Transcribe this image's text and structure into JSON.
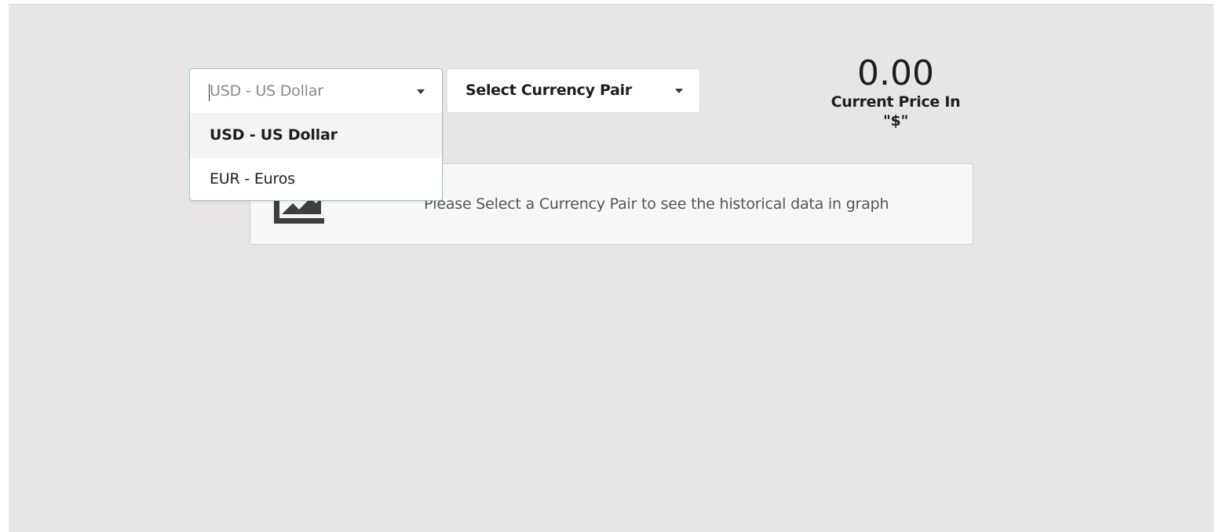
{
  "base_currency": {
    "search_text": "USD - US Dollar",
    "options": [
      {
        "label": "USD - US Dollar",
        "selected": true
      },
      {
        "label": "EUR - Euros",
        "selected": false
      }
    ]
  },
  "currency_pair": {
    "label": "Select Currency Pair"
  },
  "price": {
    "value": "0.00",
    "caption": "Current Price In \"$\""
  },
  "info": {
    "icon": "area-chart-icon",
    "message": "Please Select a Currency Pair to see the historical data in graph"
  }
}
